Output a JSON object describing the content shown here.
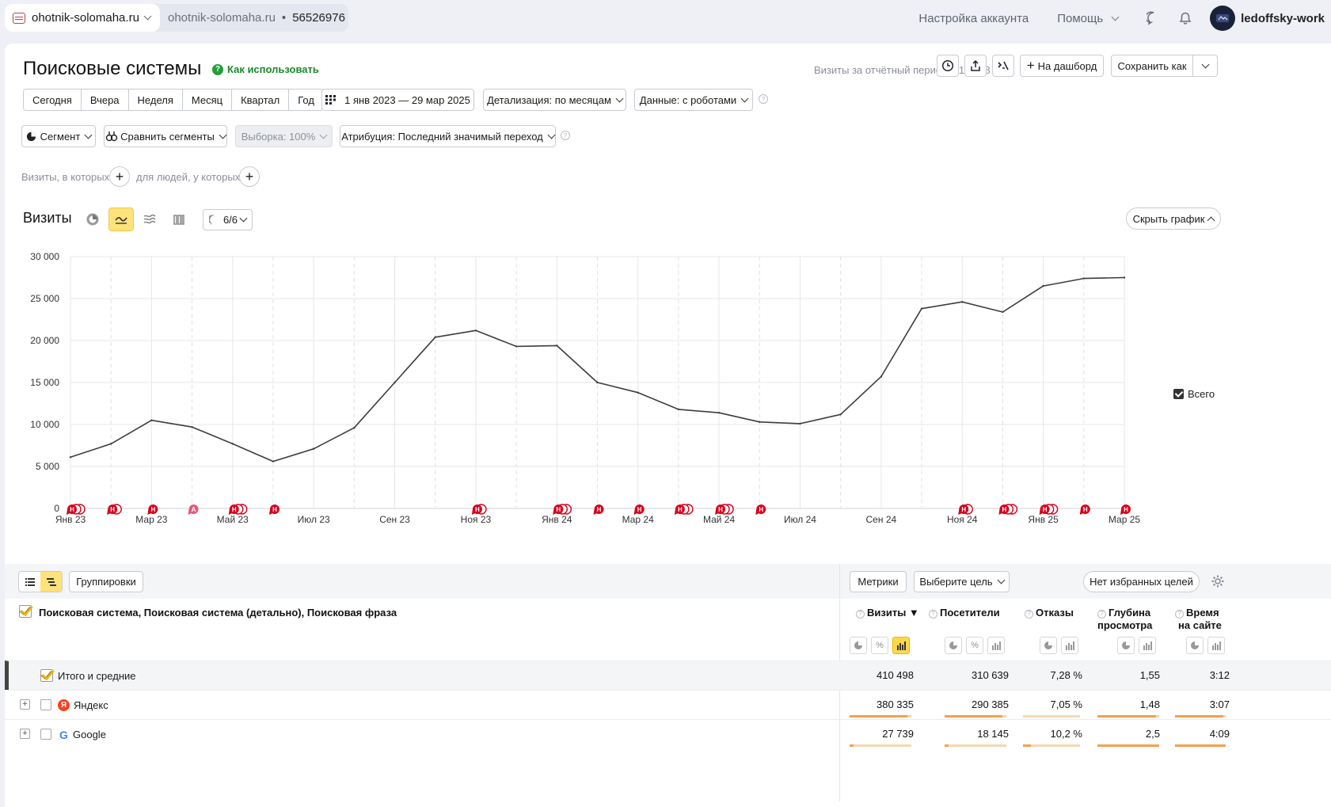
{
  "topbar": {
    "site_name": "ohotnik-solomaha.ru",
    "site_domain": "ohotnik-solomaha.ru",
    "separator": "•",
    "counter_id": "56526976",
    "account_settings": "Настройка аккаунта",
    "help": "Помощь",
    "user": "ledoffsky-work"
  },
  "header": {
    "title": "Поисковые системы",
    "howto": "Как использовать",
    "visits_total": "Визиты за отчётный период: 410 498",
    "dashboard_btn": "На дашборд",
    "save_btn": "Сохранить как"
  },
  "periods": [
    "Сегодня",
    "Вчера",
    "Неделя",
    "Месяц",
    "Квартал",
    "Год"
  ],
  "date_range": "1 янв 2023 — 29 мар 2025",
  "detail": "Детализация: по месяцам",
  "data_mode": "Данные: с роботами",
  "segment": "Сегмент",
  "compare": "Сравнить сегменты",
  "sample": "Выборка: 100%",
  "attribution": "Атрибуция: Последний значимый переход",
  "filters": {
    "visits_where": "Визиты, в которых",
    "people_where": "для людей, у которых"
  },
  "chart_header": {
    "title": "Визиты",
    "notes": "6/6",
    "hide": "Скрыть график"
  },
  "chart_data": {
    "type": "line",
    "ylim": [
      0,
      30000
    ],
    "yticks": [
      "30 000",
      "25 000",
      "20 000",
      "15 000",
      "10 000",
      "5 000",
      "0"
    ],
    "ytick_values": [
      30000,
      25000,
      20000,
      15000,
      10000,
      5000,
      0
    ],
    "xticks": [
      "Янв 23",
      "Мар 23",
      "Май 23",
      "Июл 23",
      "Сен 23",
      "Ноя 23",
      "Янв 24",
      "Мар 24",
      "Май 24",
      "Июл 24",
      "Сен 24",
      "Ноя 24",
      "Янв 25",
      "Мар 25"
    ],
    "x": [
      "2023-01",
      "2023-02",
      "2023-03",
      "2023-04",
      "2023-05",
      "2023-06",
      "2023-07",
      "2023-08",
      "2023-09",
      "2023-10",
      "2023-11",
      "2023-12",
      "2024-01",
      "2024-02",
      "2024-03",
      "2024-04",
      "2024-05",
      "2024-06",
      "2024-07",
      "2024-08",
      "2024-09",
      "2024-10",
      "2024-11",
      "2024-12",
      "2025-01",
      "2025-02",
      "2025-03"
    ],
    "series": [
      {
        "name": "Всего",
        "color": "#3d3d3d",
        "values": [
          6100,
          7700,
          10500,
          9700,
          7700,
          5600,
          7100,
          9600,
          15000,
          20400,
          21200,
          19300,
          19400,
          15000,
          13800,
          11800,
          11400,
          10300,
          10100,
          11200,
          15700,
          23800,
          24600,
          23400,
          26500,
          27400,
          27500
        ]
      }
    ],
    "grid": true,
    "legend": "right"
  },
  "annotations": [
    {
      "month": 0,
      "label": "Н",
      "count": 3,
      "color": "#d8001b"
    },
    {
      "month": 1,
      "label": "Н",
      "count": 2,
      "color": "#d8001b"
    },
    {
      "month": 2,
      "label": "Н",
      "count": 1,
      "color": "#d8001b"
    },
    {
      "month": 3,
      "label": "А",
      "count": 1,
      "color": "#e8577a"
    },
    {
      "month": 4,
      "label": "Н",
      "count": 3,
      "color": "#d8001b"
    },
    {
      "month": 5,
      "label": "Н",
      "count": 1,
      "color": "#d8001b"
    },
    {
      "month": 10,
      "label": "Н",
      "count": 2,
      "color": "#d8001b"
    },
    {
      "month": 12,
      "label": "Н",
      "count": 3,
      "color": "#d8001b"
    },
    {
      "month": 13,
      "label": "Н",
      "count": 1,
      "color": "#d8001b"
    },
    {
      "month": 14,
      "label": "Н",
      "count": 1,
      "color": "#d8001b"
    },
    {
      "month": 15,
      "label": "Н",
      "count": 3,
      "color": "#d8001b"
    },
    {
      "month": 16,
      "label": "Н",
      "count": 3,
      "color": "#d8001b"
    },
    {
      "month": 17,
      "label": "Н",
      "count": 1,
      "color": "#d8001b"
    },
    {
      "month": 22,
      "label": "Н",
      "count": 2,
      "color": "#d8001b"
    },
    {
      "month": 23,
      "label": "Н",
      "count": 3,
      "color": "#d8001b"
    },
    {
      "month": 24,
      "label": "Н",
      "count": 3,
      "color": "#d8001b"
    },
    {
      "month": 25,
      "label": "Н",
      "count": 1,
      "color": "#d8001b"
    },
    {
      "month": 26,
      "label": "Н",
      "count": 1,
      "color": "#d8001b"
    }
  ],
  "table": {
    "groupings": "Группировки",
    "metrics": "Метрики",
    "goal": "Выберите цель",
    "favorites": "Нет избранных целей",
    "dimensions": "Поисковая система, Поисковая система (детально), Поисковая фраза",
    "columns": [
      "Визиты",
      "Посетители",
      "Отказы",
      "Глубина просмотра",
      "Время на сайте"
    ],
    "col_head_1": [
      "Визиты ▼",
      "Посетители",
      "Отказы",
      "Глубина",
      "Время"
    ],
    "col_head_2": [
      "",
      "",
      "",
      "просмотра",
      "на сайте"
    ],
    "rows": [
      {
        "label": "Итого и средние",
        "values": [
          "410 498",
          "310 639",
          "7,28 %",
          "1,55",
          "3:12"
        ]
      },
      {
        "label": "Яндекс",
        "values": [
          "380 335",
          "290 385",
          "7,05 %",
          "1,48",
          "3:07"
        ],
        "bars": [
          0.93,
          0.93,
          0.97,
          0.95,
          0.96
        ]
      },
      {
        "label": "Google",
        "values": [
          "27 739",
          "18 145",
          "10,2 %",
          "2,5",
          "4:09"
        ],
        "bars": [
          0.07,
          0.06,
          0.14,
          1.0,
          1.0
        ]
      }
    ]
  }
}
